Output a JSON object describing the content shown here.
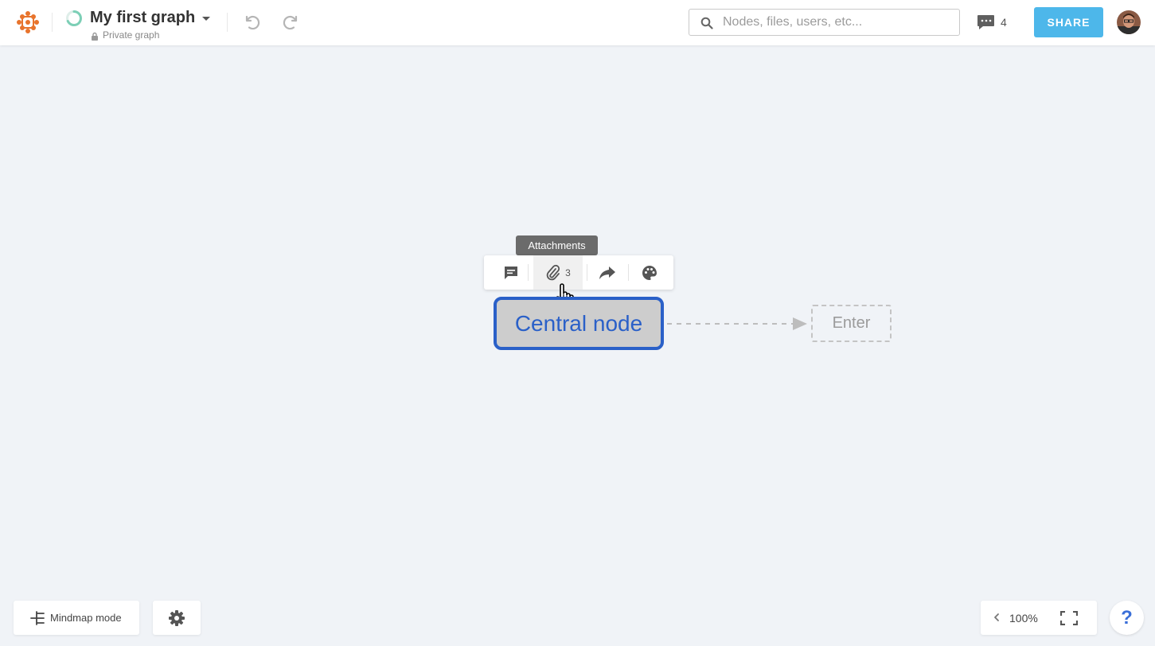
{
  "header": {
    "title": "My first graph",
    "privacy": "Private graph",
    "search_placeholder": "Nodes, files, users, etc...",
    "comments_count": "4",
    "share_label": "SHARE"
  },
  "canvas": {
    "tooltip": "Attachments",
    "attachments_count": "3",
    "central_node": "Central node",
    "enter_node": "Enter"
  },
  "footer": {
    "mindmap_label": "Mindmap mode",
    "zoom": "100%",
    "help": "?"
  },
  "colors": {
    "accent": "#4db7ea",
    "node_border": "#2a60c8",
    "node_fill": "#cdcdcd",
    "logo": "#e8742c"
  },
  "icons": [
    "app-logo-icon",
    "sync-progress-icon",
    "chevron-down-icon",
    "lock-icon",
    "undo-icon",
    "redo-icon",
    "search-icon",
    "comments-icon",
    "comment-icon",
    "paperclip-icon",
    "share-arrow-icon",
    "palette-icon",
    "pointer-cursor-icon",
    "mindmap-icon",
    "gear-icon",
    "chevron-left-icon",
    "fullscreen-icon"
  ]
}
